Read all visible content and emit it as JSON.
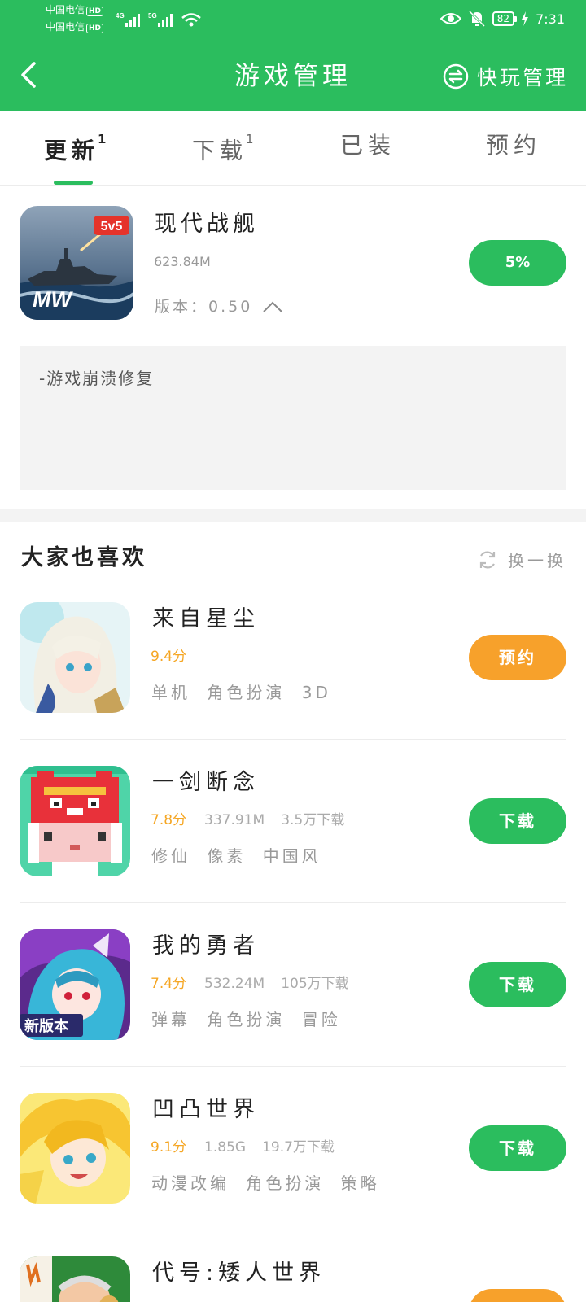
{
  "status_bar": {
    "carrier1": "中国电信",
    "carrier2": "中国电信",
    "hd": "HD",
    "net1": "4G",
    "net2": "5G",
    "battery": "82",
    "time": "7:31"
  },
  "header": {
    "title": "游戏管理",
    "quick_manage": "快玩管理"
  },
  "tabs": [
    {
      "label": "更新",
      "badge": "1"
    },
    {
      "label": "下载",
      "badge": "1"
    },
    {
      "label": "已装",
      "badge": ""
    },
    {
      "label": "预约",
      "badge": ""
    }
  ],
  "update_item": {
    "name": "现代战舰",
    "size": "623.84M",
    "version": "版本：0.50",
    "progress_label": "5%",
    "progress": 0.05,
    "icon_badge": "5v5",
    "icon_logo": "MW",
    "notes": "-游戏崩溃修复"
  },
  "recommend": {
    "title": "大家也喜欢",
    "refresh": "换一换",
    "games": [
      {
        "name": "来自星尘",
        "score": "9.4分",
        "size": "",
        "downloads": "",
        "tags": [
          "单机",
          "角色扮演",
          "3D"
        ],
        "action": "预约"
      },
      {
        "name": "一剑断念",
        "score": "7.8分",
        "size": "337.91M",
        "downloads": "3.5万下载",
        "tags": [
          "修仙",
          "像素",
          "中国风"
        ],
        "action": "下载"
      },
      {
        "name": "我的勇者",
        "score": "7.4分",
        "size": "532.24M",
        "downloads": "105万下载",
        "tags": [
          "弹幕",
          "角色扮演",
          "冒险"
        ],
        "action": "下载",
        "icon_badge": "新版本"
      },
      {
        "name": "凹凸世界",
        "score": "9.1分",
        "size": "1.85G",
        "downloads": "19.7万下载",
        "tags": [
          "动漫改编",
          "角色扮演",
          "策略"
        ],
        "action": "下载"
      },
      {
        "name": "代号:矮人世界",
        "score": "",
        "size": "",
        "downloads": "",
        "tags": [],
        "action": ""
      }
    ]
  },
  "colors": {
    "brand_green": "#2bbd5e",
    "reserve_orange": "#f7a12b",
    "score_yellow": "#f5a623"
  }
}
